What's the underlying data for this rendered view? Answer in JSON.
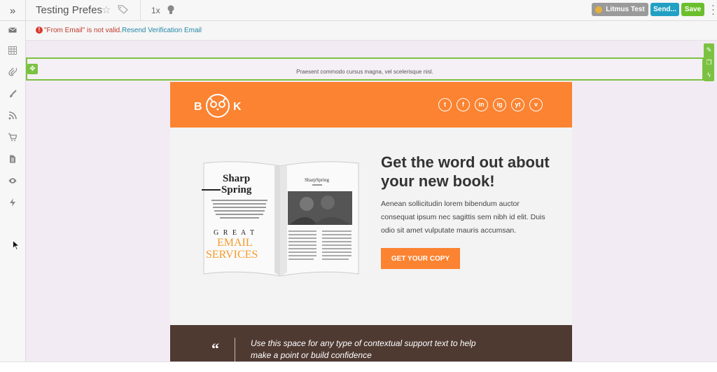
{
  "toolbar": {
    "expand_glyph": "»",
    "title": "Testing Prefes",
    "zoom": "1x",
    "litmus_label": "Litmus Test",
    "send_label": "Send...",
    "save_label": "Save"
  },
  "sidebar": {
    "icons": [
      "envelope-icon",
      "table-icon",
      "paperclip-icon",
      "brush-icon",
      "rss-icon",
      "cart-icon",
      "document-icon",
      "eye-icon",
      "bolt-icon"
    ]
  },
  "alert": {
    "message": "\"From Email\" is not valid.",
    "link": "Resend Verification Email"
  },
  "preheader": {
    "text": "Praesent commodo cursus magna, vel scelerisque nisl."
  },
  "email": {
    "brand_left": "B",
    "brand_right": "K",
    "socials": [
      "t",
      "f",
      "in",
      "ig",
      "yt",
      "v"
    ],
    "headline": "Get the word out about your new book!",
    "body": "Aenean sollicitudin lorem bibendum auctor consequat ipsum nec sagittis sem nibh id elit. Duis odio sit amet vulputate mauris accumsan.",
    "cta": "GET YOUR COPY",
    "book": {
      "title_line1": "Sharp",
      "title_line2": "Spring",
      "great": "G R E A T",
      "email": "EMAIL",
      "services": "SERVICES",
      "right_header": "SharpSpring"
    },
    "quote_mark": "“",
    "quote_text": "Use this space for any type of contextual support text to help make a point or build confidence"
  },
  "colors": {
    "orange": "#fb8331",
    "green": "#7cc242",
    "send_blue": "#21a0c4",
    "brown": "#4f3a32"
  }
}
